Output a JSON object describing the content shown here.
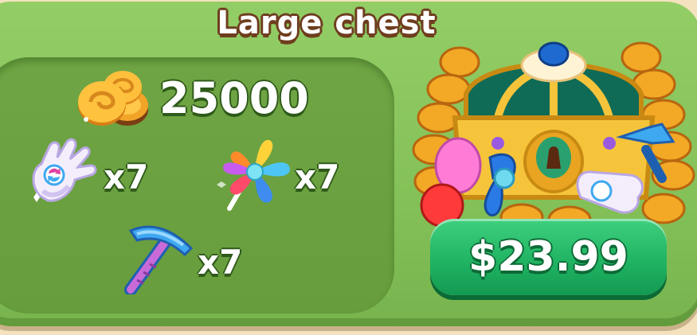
{
  "offer": {
    "title": "Large chest",
    "coins": "25000",
    "items": [
      {
        "icon": "glove-icon",
        "quantity": "x7"
      },
      {
        "icon": "pinwheel-icon",
        "quantity": "x7"
      },
      {
        "icon": "pickaxe-icon",
        "quantity": "x7"
      }
    ],
    "price": "$23.99"
  },
  "colors": {
    "panel": "#84c158",
    "inner_panel": "#6fa544",
    "buy_button": "#20b463",
    "title_outline": "#6e3d1e"
  }
}
